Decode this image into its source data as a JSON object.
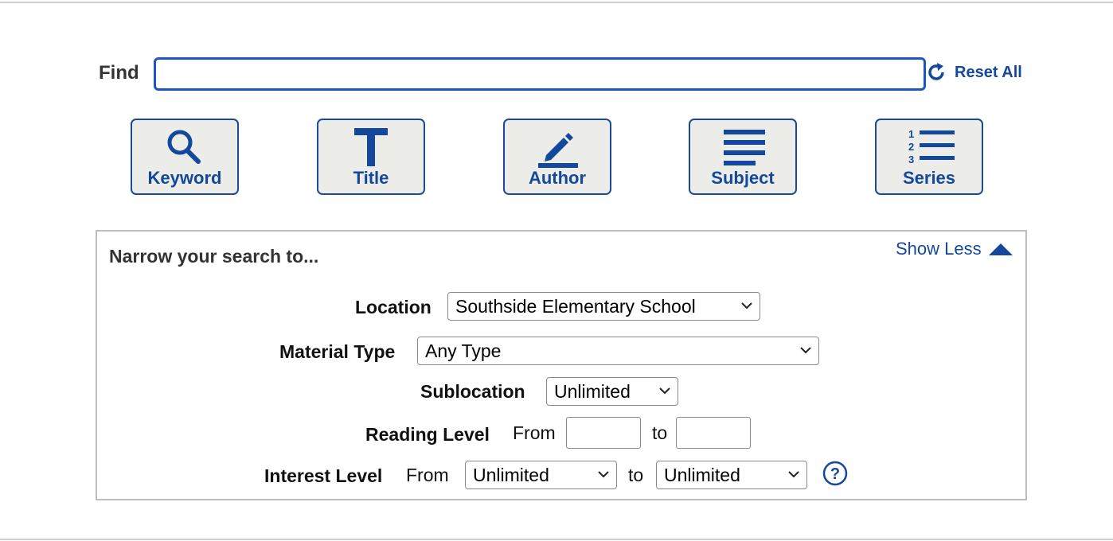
{
  "search": {
    "find_label": "Find",
    "find_value": "",
    "reset_label": "Reset All"
  },
  "search_types": [
    {
      "label": "Keyword",
      "icon": "magnifier-icon"
    },
    {
      "label": "Title",
      "icon": "title-t-icon"
    },
    {
      "label": "Author",
      "icon": "pencil-icon"
    },
    {
      "label": "Subject",
      "icon": "lines-icon"
    },
    {
      "label": "Series",
      "icon": "numbered-list-icon"
    }
  ],
  "narrow": {
    "title": "Narrow your search to...",
    "show_less_label": "Show Less",
    "location": {
      "label": "Location",
      "value": "Southside Elementary School"
    },
    "material_type": {
      "label": "Material Type",
      "value": "Any Type"
    },
    "sublocation": {
      "label": "Sublocation",
      "value": "Unlimited"
    },
    "reading_level": {
      "label": "Reading Level",
      "from_label": "From",
      "to_label": "to",
      "from_value": "",
      "to_value": ""
    },
    "interest_level": {
      "label": "Interest Level",
      "from_label": "From",
      "to_label": "to",
      "from_value": "Unlimited",
      "to_value": "Unlimited"
    }
  },
  "colors": {
    "accent": "#13489d",
    "input_border": "#1a56c6",
    "button_bg": "#ecece8"
  }
}
